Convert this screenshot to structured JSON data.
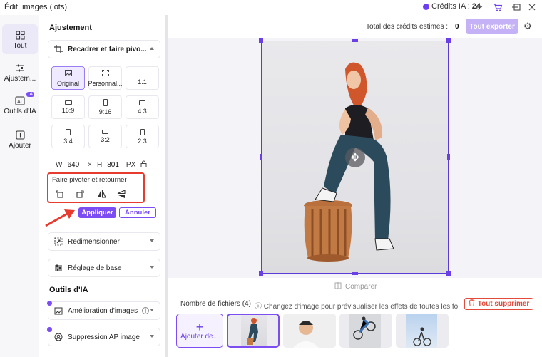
{
  "window": {
    "title": "Édit. images (lots)"
  },
  "titlebar": {
    "credits_label": "Crédits IA :",
    "credits_value": "24"
  },
  "rail": {
    "items": [
      {
        "label": "Tout",
        "icon": "grid-icon"
      },
      {
        "label": "Ajustem...",
        "icon": "sliders-icon"
      },
      {
        "label": "Outils d'IA",
        "icon": "ai-icon",
        "badge": "IA"
      },
      {
        "label": "Ajouter",
        "icon": "plus-square-icon"
      }
    ]
  },
  "panel": {
    "adjust_title": "Ajustement",
    "crop_label": "Recadrer et faire pivo...",
    "ratios": [
      "Original",
      "Personnal...",
      "1:1",
      "16:9",
      "9:16",
      "4:3",
      "3:4",
      "3:2",
      "2:3"
    ],
    "width_label": "W",
    "width_value": "640",
    "times": "×",
    "height_label": "H",
    "height_value": "801",
    "unit": "PX",
    "rotate_title": "Faire pivoter et retourner",
    "apply_label": "Appliquer",
    "cancel_label": "Annuler",
    "resize_label": "Redimensionner",
    "basic_label": "Réglage de base",
    "ai_title": "Outils d'IA",
    "enhance_label": "Amélioration d'images",
    "bg_remove_label": "Suppression AP image"
  },
  "topbar": {
    "estimate_label": "Total des crédits estimés :",
    "estimate_value": "0",
    "export_label": "Tout exporter"
  },
  "canvas": {
    "compare_label": "Comparer"
  },
  "files": {
    "count_label": "Nombre de fichiers (4)",
    "hint": "Changez d'image pour prévisualiser les effets de toutes les fonctio...",
    "delete_label": "Tout supprimer",
    "add_label": "Ajouter de..."
  },
  "colors": {
    "accent": "#7b4df3",
    "danger": "#e63b2e"
  }
}
